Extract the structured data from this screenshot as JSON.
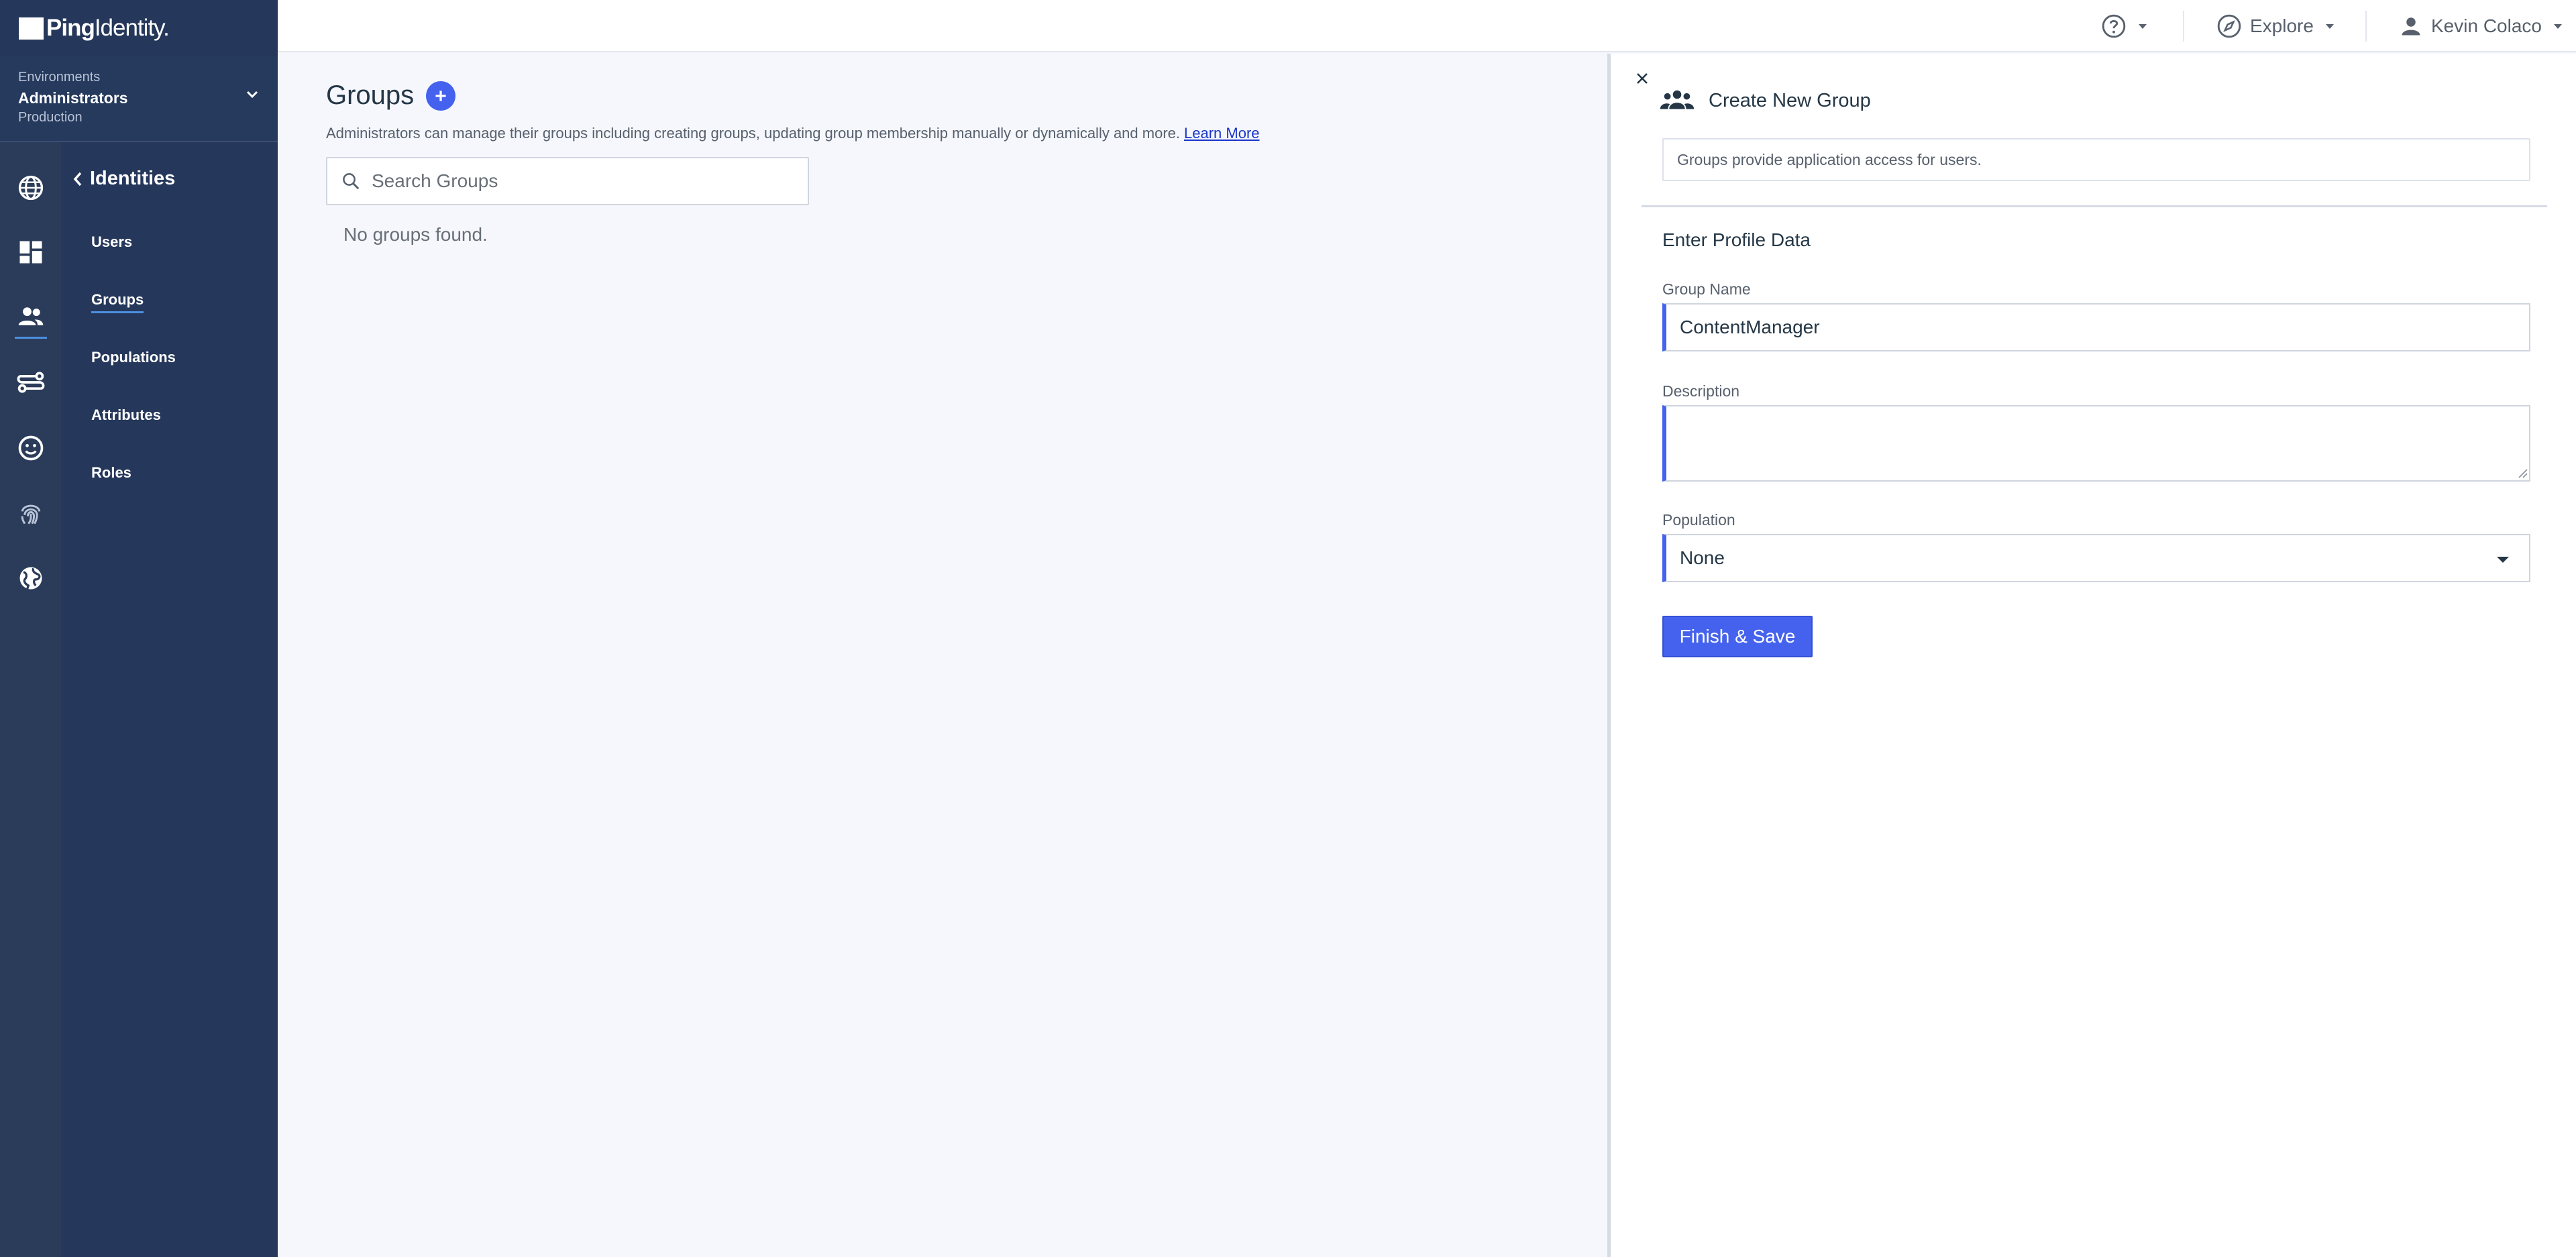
{
  "brand": {
    "name_bold": "Ping",
    "name_light": "Identity."
  },
  "environment": {
    "label": "Environments",
    "name": "Administrators",
    "type": "Production"
  },
  "rail": {
    "icons": [
      "globe-icon",
      "dashboard-icon",
      "users-icon",
      "connections-icon",
      "face-icon",
      "fingerprint-icon",
      "world-icon"
    ]
  },
  "nav": {
    "title": "Identities",
    "items": [
      {
        "label": "Users"
      },
      {
        "label": "Groups"
      },
      {
        "label": "Populations"
      },
      {
        "label": "Attributes"
      },
      {
        "label": "Roles"
      }
    ],
    "active": "Groups"
  },
  "topbar": {
    "explore": "Explore",
    "user": "Kevin Colaco"
  },
  "main": {
    "title": "Groups",
    "description": "Administrators can manage their groups including creating groups, updating group membership manually or dynamically and more.",
    "learn_more": "Learn More",
    "search_placeholder": "Search Groups",
    "empty": "No groups found."
  },
  "panel": {
    "title": "Create New Group",
    "note": "Groups provide application access for users.",
    "section": "Enter Profile Data",
    "group_name_label": "Group Name",
    "group_name_value": "ContentManager",
    "description_label": "Description",
    "description_value": "",
    "population_label": "Population",
    "population_value": "None",
    "save": "Finish & Save"
  },
  "colors": {
    "accent": "#4462ed",
    "nav_bg": "#25375a",
    "rail_bg": "#2b3c5a",
    "link": "#1a35c9"
  }
}
